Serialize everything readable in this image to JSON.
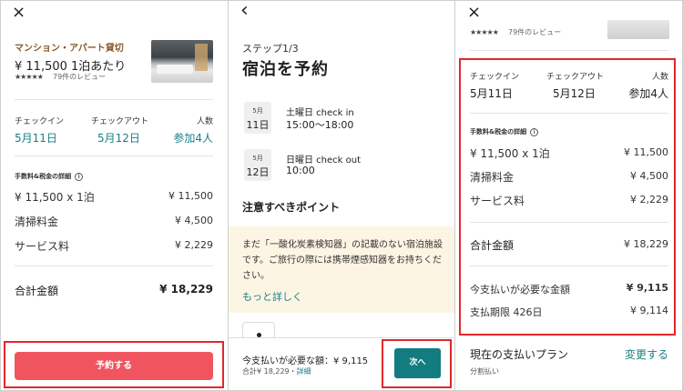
{
  "left": {
    "close_icon": "×",
    "eyebrow": "マンション・アパート貸切",
    "price_line": "¥ 11,500 1泊あたり",
    "stars": "★★★★★",
    "reviews": "79件のレビュー",
    "checkin_label": "チェックイン",
    "checkout_label": "チェックアウト",
    "guests_label": "人数",
    "checkin_value": "5月11日",
    "checkout_value": "5月12日",
    "guests_value": "参加4人",
    "fees_header": "手数料&税金の詳細",
    "info_icon": "i",
    "rows": [
      {
        "label": "¥ 11,500 x 1泊",
        "value": "¥ 11,500"
      },
      {
        "label": "清掃料金",
        "value": "¥ 4,500"
      },
      {
        "label": "サービス料",
        "value": "¥ 2,229"
      }
    ],
    "total_label": "合計金額",
    "total_value": "¥ 18,229",
    "book_button": "予約する"
  },
  "middle": {
    "back_icon": "‹",
    "step": "ステップ1/3",
    "title": "宿泊を予約",
    "events": [
      {
        "month": "5月",
        "day": "11日",
        "line1": "土曜日 check in",
        "line2": "15:00～18:00"
      },
      {
        "month": "5月",
        "day": "12日",
        "line1": "日曜日 check out",
        "line2": "10:00"
      }
    ],
    "section_title": "注意すべきポイント",
    "notice_text": "まだ「一酸化炭素検知器」の記載のない宿泊施設です。ご旅行の際には携帯煙感知器をお持ちください。",
    "learn_more": "もっと詳しく",
    "pay_now": "今支払いが必要な額：¥ 9,115",
    "total_sub": "合計¥ 18,229・",
    "details_link": "詳細",
    "next_button": "次へ"
  },
  "right": {
    "close_icon": "×",
    "stars": "★★★★★",
    "reviews": "79件のレビュー",
    "checkin_label": "チェックイン",
    "checkout_label": "チェックアウト",
    "guests_label": "人数",
    "checkin_value": "5月11日",
    "checkout_value": "5月12日",
    "guests_value": "参加4人",
    "fees_header": "手数料&税金の詳細",
    "info_icon": "i",
    "rows": [
      {
        "label": "¥ 11,500 x 1泊",
        "value": "¥ 11,500"
      },
      {
        "label": "清掃料金",
        "value": "¥ 4,500"
      },
      {
        "label": "サービス料",
        "value": "¥ 2,229"
      }
    ],
    "total_label": "合計金額",
    "total_value": "¥ 18,229",
    "pay_now_label": "今支払いが必要な金額",
    "pay_now_value": "¥ 9,115",
    "deadline_label": "支払期限 426日",
    "deadline_value": "¥ 9,114",
    "plan_label": "現在の支払いプラン",
    "plan_change": "変更する",
    "plan_sub": "分割払い"
  },
  "colors": {
    "accent_teal": "#1a7f86",
    "book_button": "#f0555f",
    "next_button": "#127c80",
    "highlight_frame": "#e3262c",
    "notice_bg": "#fdf5e4"
  }
}
